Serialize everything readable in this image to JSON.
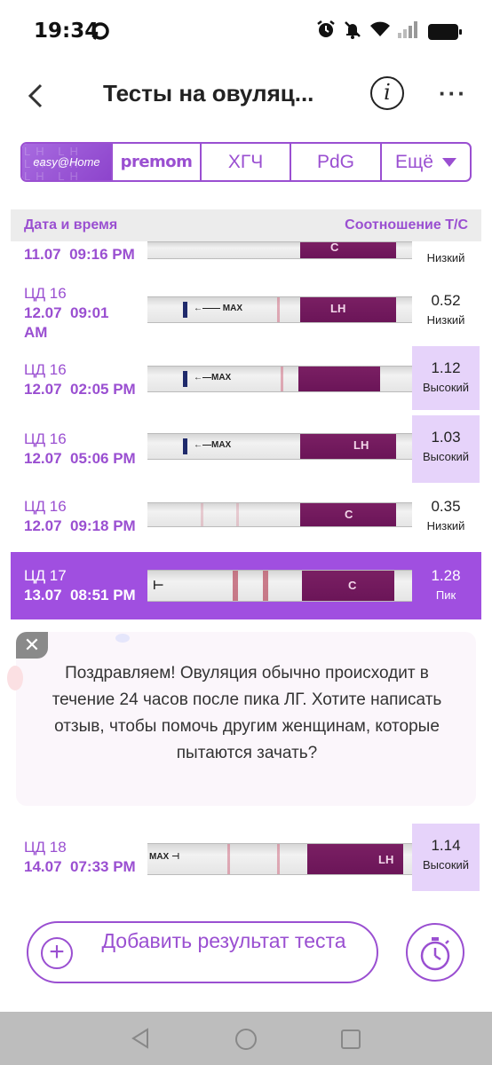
{
  "status_bar": {
    "time": "19:34",
    "icons": [
      "chat-bubble-icon",
      "alarm-icon",
      "mute-icon",
      "wifi-icon",
      "signal-icon",
      "battery-icon"
    ]
  },
  "header": {
    "title": "Тесты на овуляц...",
    "info_glyph": "i",
    "more_glyph": "···"
  },
  "brand_tabs": [
    {
      "label": "easy@Home",
      "selected": true
    },
    {
      "label": "premom",
      "selected": false
    },
    {
      "label": "ХГЧ",
      "selected": false
    },
    {
      "label": "PdG",
      "selected": false
    },
    {
      "label": "Ещё",
      "selected": false
    }
  ],
  "table": {
    "col_date": "Дата и время",
    "col_ratio": "Соотношение T/C"
  },
  "rows": [
    {
      "cycle": "",
      "date": "11.07",
      "time": "09:16 PM",
      "ratio": "",
      "level": "Низкий",
      "high": false
    },
    {
      "cycle": "ЦД 16",
      "date": "12.07",
      "time": "09:01 AM",
      "ratio": "0.52",
      "level": "Низкий",
      "high": false
    },
    {
      "cycle": "ЦД 16",
      "date": "12.07",
      "time": "02:05 PM",
      "ratio": "1.12",
      "level": "Высокий",
      "high": true
    },
    {
      "cycle": "ЦД 16",
      "date": "12.07",
      "time": "05:06 PM",
      "ratio": "1.03",
      "level": "Высокий",
      "high": true
    },
    {
      "cycle": "ЦД 16",
      "date": "12.07",
      "time": "09:18 PM",
      "ratio": "0.35",
      "level": "Низкий",
      "high": false
    },
    {
      "cycle": "ЦД 17",
      "date": "13.07",
      "time": "08:51 PM",
      "ratio": "1.28",
      "level": "Пик",
      "high": true
    },
    {
      "cycle": "ЦД 18",
      "date": "14.07",
      "time": "07:33 PM",
      "ratio": "1.14",
      "level": "Высокий",
      "high": true
    }
  ],
  "congrats": {
    "close_glyph": "✕",
    "text": "Поздравляем! Овуляция обычно происходит в течение 24 часов после пика ЛГ. Хотите написать отзыв, чтобы помочь другим женщинам, которые пытаются зачать?"
  },
  "actions": {
    "add_result_label": "Добавить результат теста",
    "timer_icon": "stopwatch-icon"
  },
  "colors": {
    "accent": "#9a4fd1",
    "peak_row": "#a04fe0",
    "high_bg": "#e6d3fa",
    "strip_handle": "#6b1558"
  },
  "strip_text": {
    "lh": "LH",
    "c": "C",
    "max": "MAX"
  }
}
